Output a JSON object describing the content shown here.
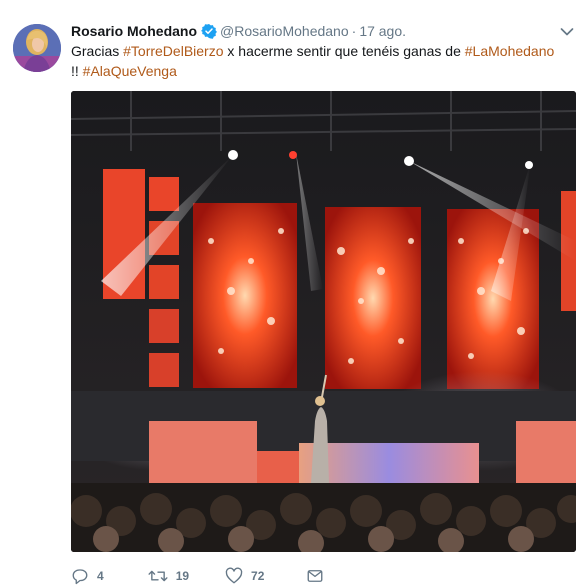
{
  "tweet": {
    "author_name": "Rosario Mohedano",
    "handle": "@RosarioMohedano",
    "separator": "·",
    "time": "17 ago.",
    "text_parts": {
      "p1": "Gracias ",
      "tag1": "#TorreDelBierzo",
      "p2": " x hacerme sentir que tenéis ganas de ",
      "tag2": "#LaMohedano",
      "p3": "!! ",
      "tag3": "#AlaQueVenga"
    }
  },
  "actions": {
    "reply_count": "4",
    "retweet_count": "19",
    "like_count": "72"
  },
  "icons": {
    "verified": "verified-badge-icon",
    "more": "chevron-down-icon",
    "reply": "reply-icon",
    "retweet": "retweet-icon",
    "like": "heart-icon",
    "message": "direct-message-icon"
  },
  "colors": {
    "hashtag": "#b05a1a",
    "verified": "#1da1f2",
    "muted": "#657786"
  }
}
